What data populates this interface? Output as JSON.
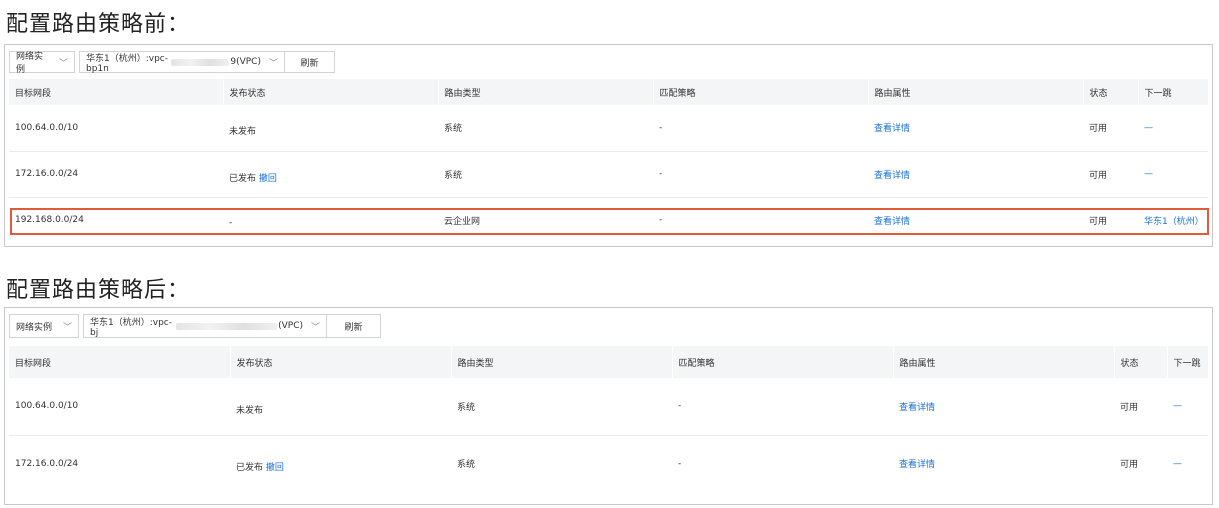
{
  "sections": [
    {
      "title": "配置路由策略前：",
      "toolbar": {
        "instance_type": "网络实例",
        "vpc_prefix": "华东1（杭州）:vpc-bp1n",
        "vpc_suffix": "9(VPC)",
        "refresh": "刷新"
      },
      "headers": [
        "目标网段",
        "发布状态",
        "路由类型",
        "匹配策略",
        "路由属性",
        "状态",
        "下一跳"
      ],
      "rows": [
        {
          "cidr": "100.64.0.0/10",
          "publish": "未发布",
          "revoke": "",
          "type": "系统",
          "policy": "-",
          "attr": "查看详情",
          "status": "可用",
          "next_hop": "—"
        },
        {
          "cidr": "172.16.0.0/24",
          "publish": "已发布",
          "revoke": "撤回",
          "type": "系统",
          "policy": "-",
          "attr": "查看详情",
          "status": "可用",
          "next_hop": "—"
        },
        {
          "cidr": "192.168.0.0/24",
          "publish": "-",
          "revoke": "",
          "type": "云企业网",
          "policy": "-",
          "attr": "查看详情",
          "status": "可用",
          "next_hop": "华东1（杭州）"
        }
      ]
    },
    {
      "title": "配置路由策略后：",
      "toolbar": {
        "instance_type": "网络实例",
        "vpc_prefix": "华东1（杭州）:vpc-bj",
        "vpc_suffix": "(VPC)",
        "refresh": "刷新"
      },
      "headers": [
        "目标网段",
        "发布状态",
        "路由类型",
        "匹配策略",
        "路由属性",
        "状态",
        "下一跳"
      ],
      "rows": [
        {
          "cidr": "100.64.0.0/10",
          "publish": "未发布",
          "revoke": "",
          "type": "系统",
          "policy": "-",
          "attr": "查看详情",
          "status": "可用",
          "next_hop": "—"
        },
        {
          "cidr": "172.16.0.0/24",
          "publish": "已发布",
          "revoke": "撤回",
          "type": "系统",
          "policy": "-",
          "attr": "查看详情",
          "status": "可用",
          "next_hop": "—"
        }
      ]
    }
  ],
  "colors": {
    "link": "#1a6fd4",
    "highlight": "#e05a3c",
    "header_bg": "#f4f5f7"
  }
}
